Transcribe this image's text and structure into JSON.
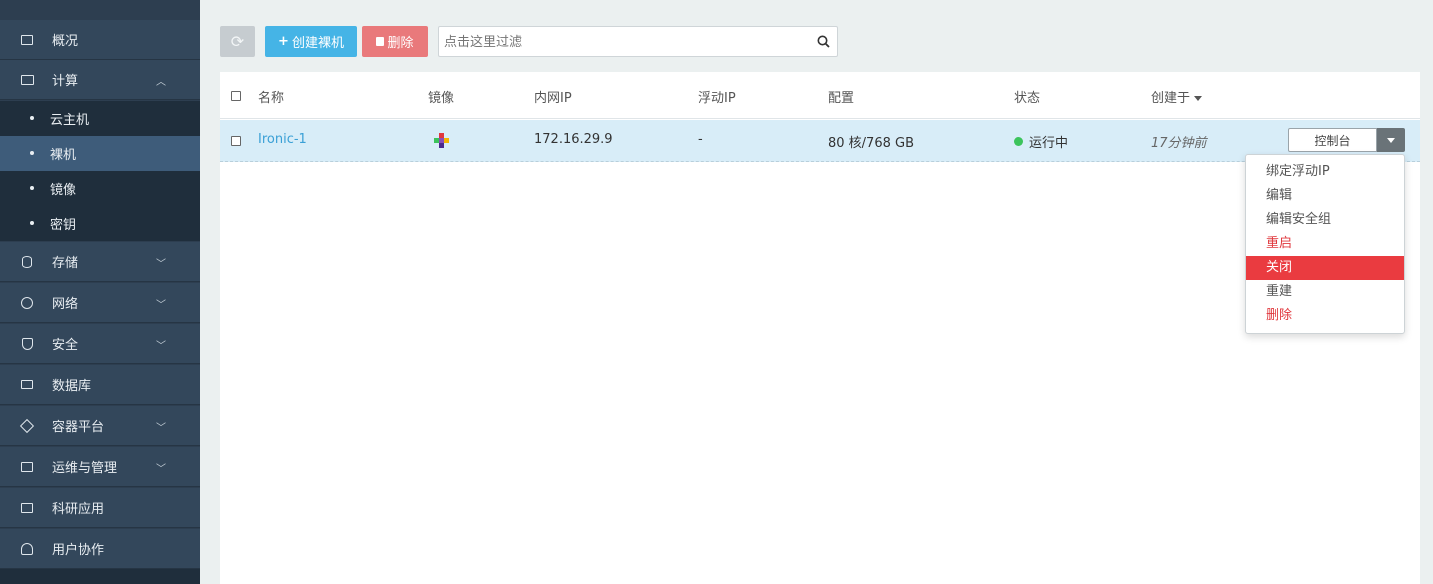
{
  "sidebar": {
    "items": [
      {
        "label": "概况",
        "icon": "overview-icon"
      },
      {
        "label": "计算",
        "icon": "monitor-icon",
        "expanded": true
      },
      {
        "label": "存储",
        "icon": "database-icon"
      },
      {
        "label": "网络",
        "icon": "network-icon"
      },
      {
        "label": "安全",
        "icon": "shield-icon"
      },
      {
        "label": "数据库",
        "icon": "database-server-icon"
      },
      {
        "label": "容器平台",
        "icon": "container-icon"
      },
      {
        "label": "运维与管理",
        "icon": "ops-icon"
      },
      {
        "label": "科研应用",
        "icon": "research-icon"
      },
      {
        "label": "用户协作",
        "icon": "users-icon"
      }
    ],
    "compute_sub": [
      {
        "label": "云主机"
      },
      {
        "label": "裸机",
        "active": true
      },
      {
        "label": "镜像"
      },
      {
        "label": "密钥"
      }
    ]
  },
  "toolbar": {
    "create_label": "创建裸机",
    "delete_label": "删除",
    "search_placeholder": "点击这里过滤"
  },
  "table": {
    "headers": [
      "名称",
      "镜像",
      "内网IP",
      "浮动IP",
      "配置",
      "状态",
      "创建于"
    ],
    "rows": [
      {
        "name": "Ironic-1",
        "image": "openstack-logo",
        "internal_ip": "172.16.29.9",
        "floating_ip": "-",
        "config": "80 核/768 GB",
        "status": "运行中",
        "created": "17分钟前",
        "action": "控制台"
      }
    ]
  },
  "dropdown": {
    "items": [
      {
        "label": "绑定浮动IP"
      },
      {
        "label": "编辑"
      },
      {
        "label": "编辑安全组"
      },
      {
        "label": "重启",
        "style": "danger"
      },
      {
        "label": "关闭",
        "style": "hover"
      },
      {
        "label": "重建"
      },
      {
        "label": "删除",
        "style": "danger"
      }
    ]
  },
  "colors": {
    "sidebar_bg": "#2d3e50",
    "accent": "#45b4e6",
    "danger": "#e9797b",
    "status_running": "#3cc45c",
    "row_highlight": "#d8edf8"
  }
}
